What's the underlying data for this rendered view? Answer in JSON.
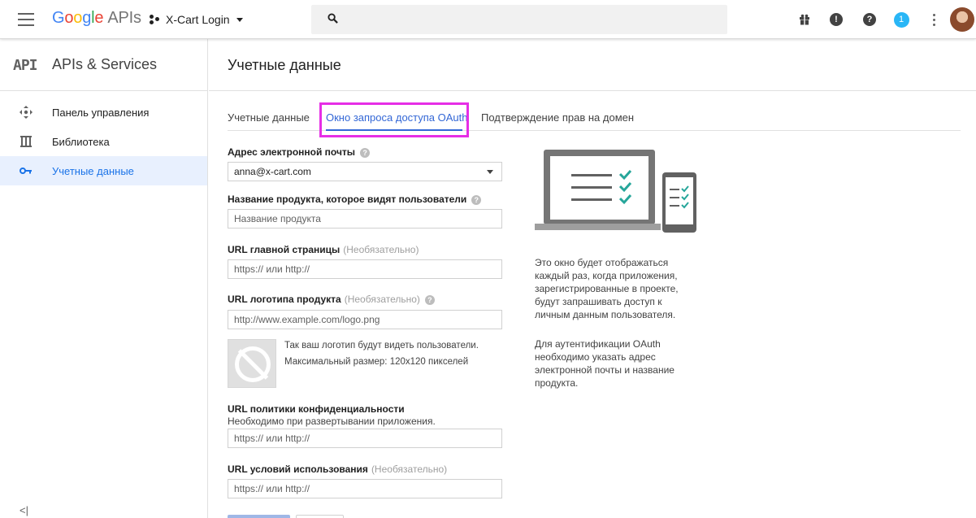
{
  "topbar": {
    "brand_google": [
      "G",
      "o",
      "o",
      "g",
      "l",
      "e"
    ],
    "brand_apis": "APIs",
    "project_name": "X-Cart Login",
    "notification_count": "1",
    "help_glyph": "?",
    "feedback_glyph": "!"
  },
  "sidebar": {
    "logo": "API",
    "title": "APIs & Services",
    "items": [
      {
        "label": "Панель управления",
        "icon": "dashboard-icon"
      },
      {
        "label": "Библиотека",
        "icon": "library-icon"
      },
      {
        "label": "Учетные данные",
        "icon": "key-icon",
        "active": true
      }
    ],
    "collapse_glyph": "<|"
  },
  "main": {
    "title": "Учетные данные",
    "tabs": [
      {
        "label": "Учетные данные"
      },
      {
        "label": "Окно запроса доступа OAuth",
        "active": true
      },
      {
        "label": "Подтверждение прав на домен"
      }
    ],
    "form": {
      "email_label": "Адрес электронной почты",
      "email_value": "anna@x-cart.com",
      "product_label": "Название продукта, которое видят пользователи",
      "product_placeholder": "Название продукта",
      "homepage_label": "URL главной страницы",
      "homepage_optional": "(Необязательно)",
      "homepage_placeholder": "https:// или http://",
      "logo_label": "URL логотипа продукта",
      "logo_optional": "(Необязательно)",
      "logo_placeholder": "http://www.example.com/logo.png",
      "logo_hint_1": "Так ваш логотип будут видеть пользователи.",
      "logo_hint_2": "Максимальный размер: 120x120 пикселей",
      "privacy_label": "URL политики конфиденциальности",
      "privacy_note": "Необходимо при развертывании приложения.",
      "privacy_placeholder": "https:// или http://",
      "terms_label": "URL условий использования",
      "terms_optional": "(Необязательно)",
      "terms_placeholder": "https:// или http://"
    },
    "info_1": "Это окно будет отображаться каждый раз, когда приложения, зарегистрированные в проекте, будут запрашивать доступ к личным данным пользователя.",
    "info_2": "Для аутентификации OAuth необходимо указать адрес электронной почты и название продукта."
  },
  "colors": {
    "accent": "#3367d6",
    "highlight": "#e62ee6",
    "check": "#26a69a"
  }
}
